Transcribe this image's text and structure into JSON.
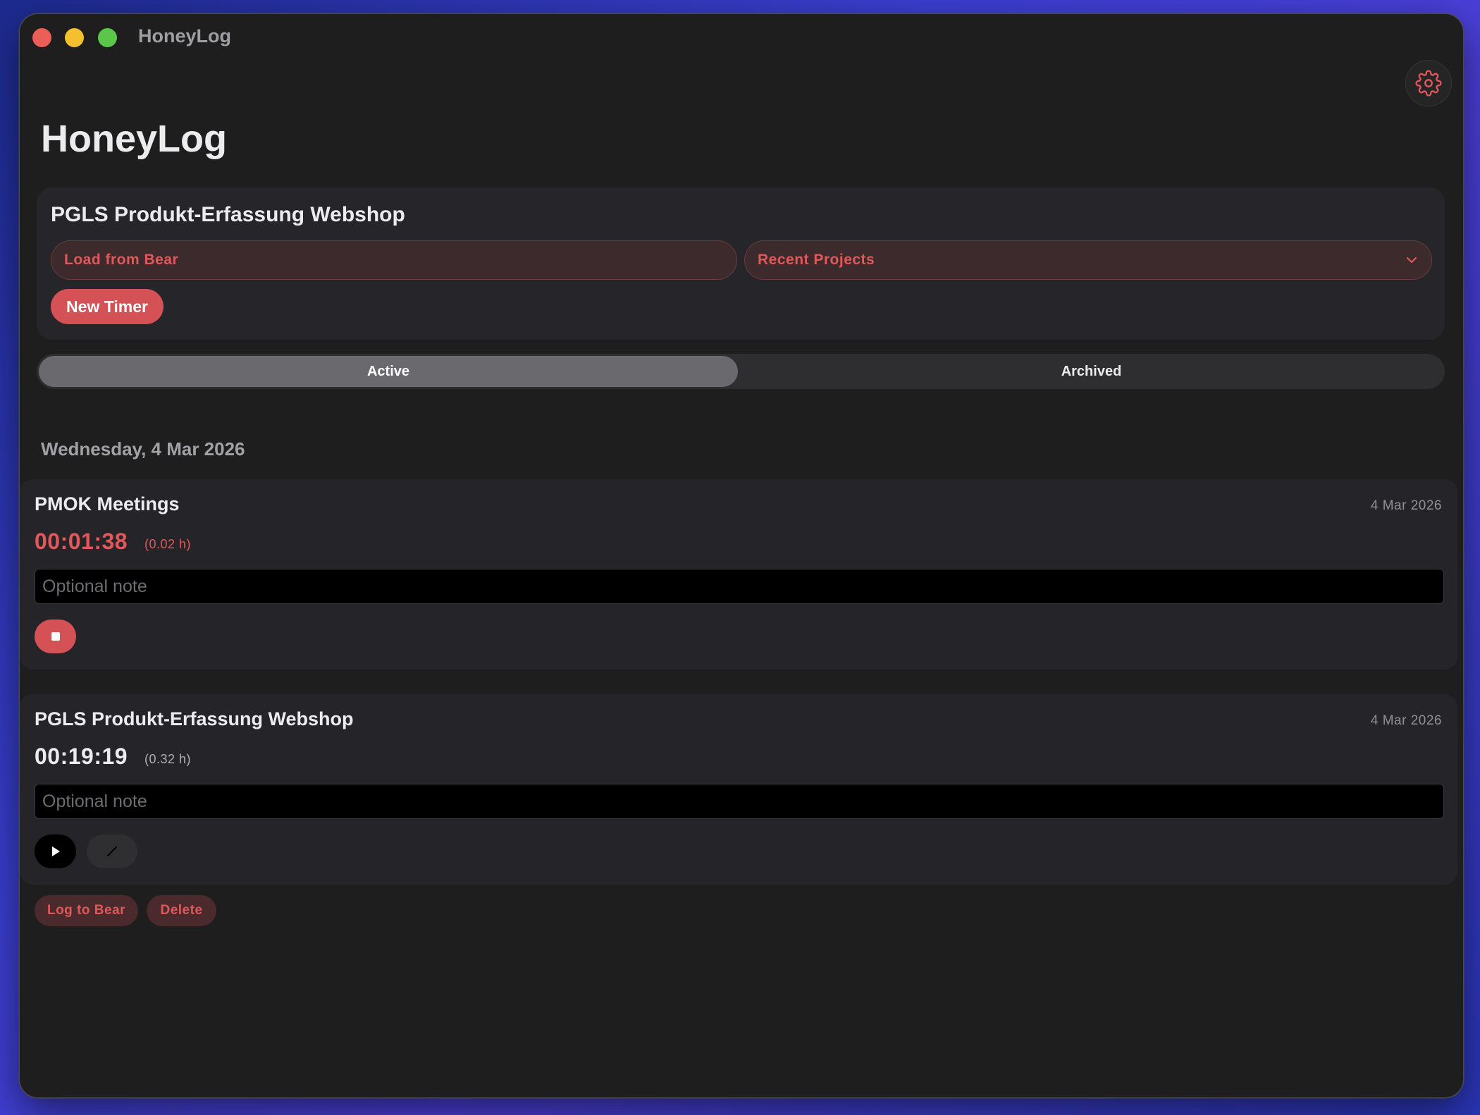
{
  "window": {
    "title": "HoneyLog"
  },
  "app": {
    "title": "HoneyLog"
  },
  "project_panel": {
    "title": "PGLS Produkt-Erfassung Webshop",
    "load_button": "Load from Bear",
    "recent_projects": "Recent Projects",
    "new_timer_button": "New Timer"
  },
  "tabs": {
    "active": "Active",
    "archived": "Archived",
    "selected": "Active"
  },
  "day_heading": "Wednesday, 4 Mar 2026",
  "timers": [
    {
      "name": "PMOK Meetings",
      "date": "4 Mar 2026",
      "elapsed": "00:01:38",
      "hours": "(0.02 h)",
      "note_placeholder": "Optional note",
      "state": "running"
    },
    {
      "name": "PGLS Produkt-Erfassung Webshop",
      "date": "4 Mar 2026",
      "elapsed": "00:19:19",
      "hours": "(0.32 h)",
      "note_placeholder": "Optional note",
      "state": "paused"
    }
  ],
  "actions": {
    "log_to_bear": "Log to Bear",
    "delete": "Delete"
  },
  "colors": {
    "accent": "#e0585a",
    "accent_button": "#d45155",
    "window_bg": "#1e1e1f",
    "card_bg": "#252529"
  },
  "icons": {
    "settings": "gear-icon",
    "dropdown": "chevron-down-icon",
    "stop": "stop-icon",
    "play": "play-icon",
    "edit": "pencil-icon"
  }
}
